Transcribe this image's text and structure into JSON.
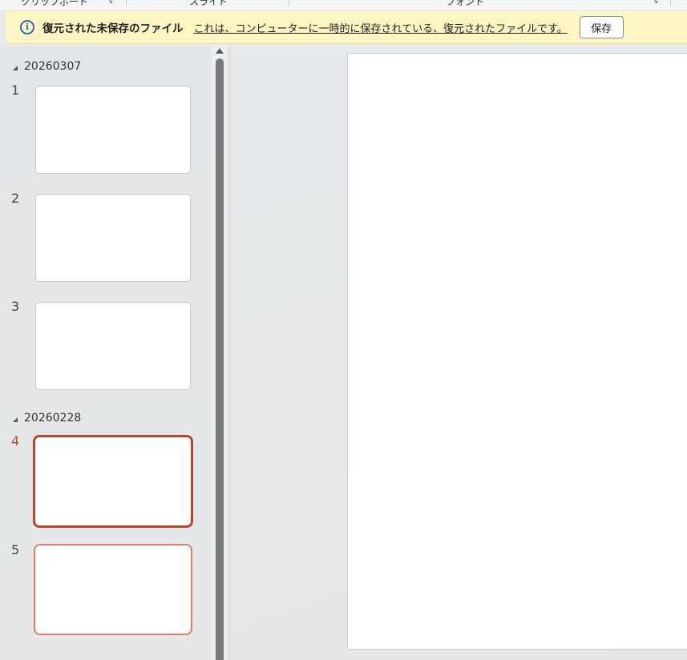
{
  "ribbon": {
    "groups": [
      "クリップボード",
      "スライド",
      "フォント"
    ]
  },
  "message_bar": {
    "title": "復元された未保存のファイル",
    "text": "これは、コンピューターに一時的に保存されている、復元されたファイルです。",
    "save_label": "保存",
    "icon": "info-icon"
  },
  "thumbnails": {
    "sections": [
      {
        "name": "20260307"
      },
      {
        "name": "20260228"
      }
    ],
    "slides": [
      {
        "number": "1",
        "section": "20260307",
        "state": "normal"
      },
      {
        "number": "2",
        "section": "20260307",
        "state": "normal"
      },
      {
        "number": "3",
        "section": "20260307",
        "state": "normal"
      },
      {
        "number": "4",
        "section": "20260228",
        "state": "current"
      },
      {
        "number": "5",
        "section": "20260228",
        "state": "selected"
      }
    ]
  },
  "colors": {
    "message_bar_bg": "#fdf6c3",
    "current_slide_border": "#b8452d",
    "selected_slide_border": "#e27a68",
    "info_icon": "#2f6db5"
  }
}
